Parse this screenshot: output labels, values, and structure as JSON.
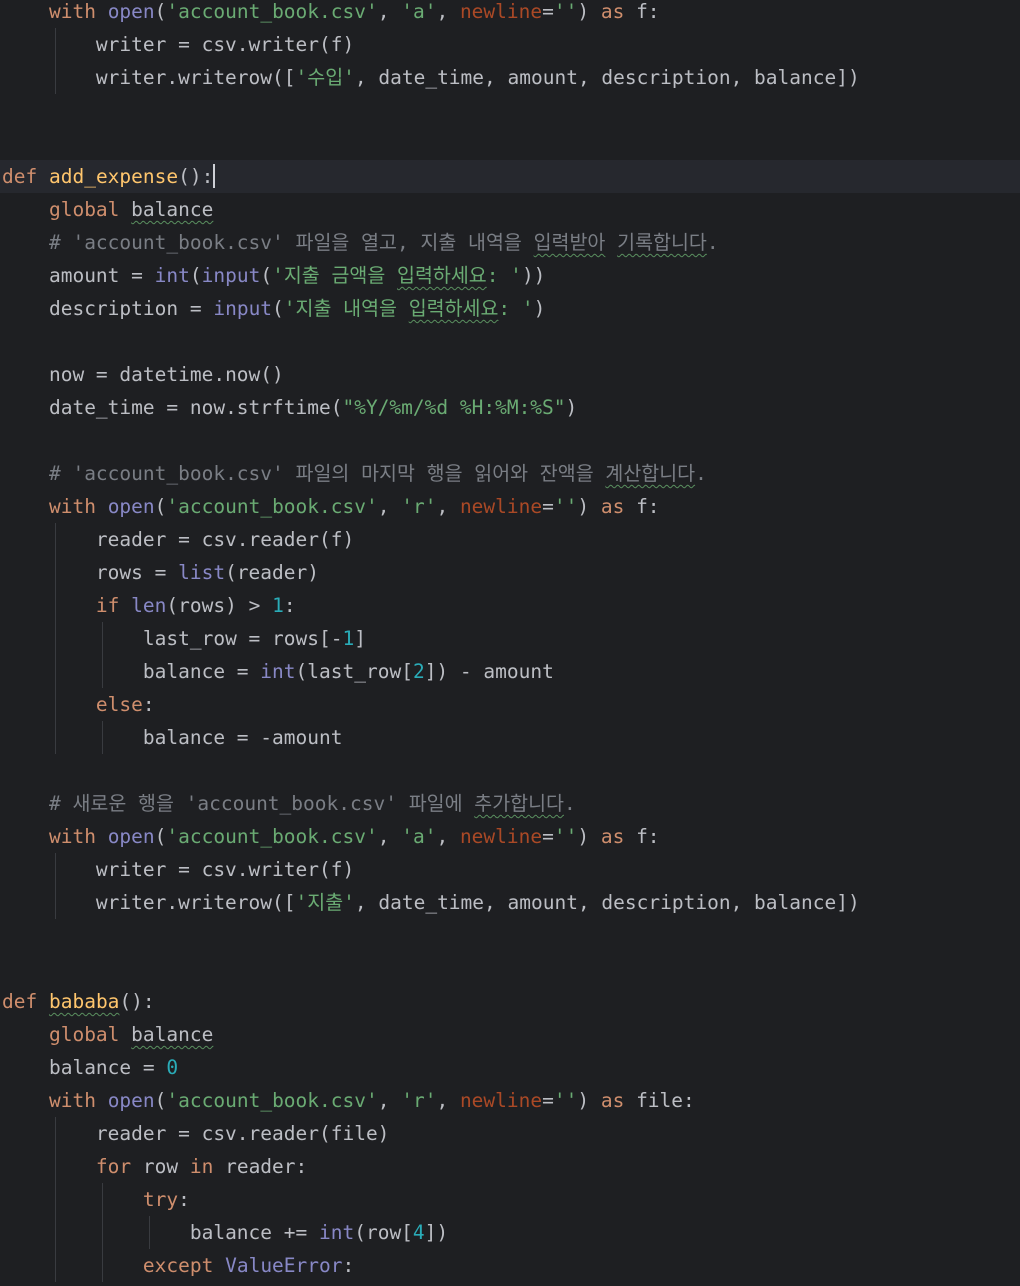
{
  "editor": {
    "language": "python",
    "caret_line": 6,
    "colors": {
      "background": "#1e1f22",
      "current_line": "#26282e",
      "keyword": "#cf8e6d",
      "builtin": "#8888c6",
      "string": "#6aab73",
      "number": "#2aacb8",
      "comment": "#7a7e85",
      "parameter": "#aa4926",
      "function_def": "#ffc66d",
      "plain": "#bcbec4"
    },
    "lines": [
      {
        "indent": 1,
        "tokens": [
          {
            "t": "with",
            "c": "kw"
          },
          {
            "t": " "
          },
          {
            "t": "open",
            "c": "bi"
          },
          {
            "t": "("
          },
          {
            "t": "'account_book.csv'",
            "c": "str"
          },
          {
            "t": ", "
          },
          {
            "t": "'a'",
            "c": "str"
          },
          {
            "t": ", "
          },
          {
            "t": "newline",
            "c": "param"
          },
          {
            "t": "="
          },
          {
            "t": "''",
            "c": "str"
          },
          {
            "t": ") "
          },
          {
            "t": "as",
            "c": "kw"
          },
          {
            "t": " f:"
          }
        ]
      },
      {
        "indent": 2,
        "tokens": [
          {
            "t": "writer = csv.writer(f)"
          }
        ]
      },
      {
        "indent": 2,
        "tokens": [
          {
            "t": "writer.writerow(["
          },
          {
            "t": "'수입'",
            "c": "str"
          },
          {
            "t": ", date_time, amount, description, balance])"
          }
        ]
      },
      {
        "indent": 0,
        "tokens": []
      },
      {
        "indent": 0,
        "tokens": []
      },
      {
        "indent": 0,
        "tokens": [
          {
            "t": "def",
            "c": "kw"
          },
          {
            "t": " "
          },
          {
            "t": "add_expense",
            "c": "def"
          },
          {
            "t": "():"
          }
        ]
      },
      {
        "indent": 1,
        "tokens": [
          {
            "t": "global",
            "c": "kw"
          },
          {
            "t": " "
          },
          {
            "t": "balance",
            "w": true
          }
        ]
      },
      {
        "indent": 1,
        "tokens": [
          {
            "t": "# 'account_book.csv' 파일을 열고, 지출 내역을 ",
            "c": "cm"
          },
          {
            "t": "입력받아",
            "c": "cm",
            "w": true
          },
          {
            "t": " ",
            "c": "cm"
          },
          {
            "t": "기록합니다",
            "c": "cm",
            "w": true
          },
          {
            "t": ".",
            "c": "cm"
          }
        ]
      },
      {
        "indent": 1,
        "tokens": [
          {
            "t": "amount = "
          },
          {
            "t": "int",
            "c": "bi"
          },
          {
            "t": "("
          },
          {
            "t": "input",
            "c": "bi"
          },
          {
            "t": "("
          },
          {
            "t": "'지출 금액을 ",
            "c": "str"
          },
          {
            "t": "입력하세요",
            "c": "str",
            "w": true
          },
          {
            "t": ": '",
            "c": "str"
          },
          {
            "t": "))"
          }
        ]
      },
      {
        "indent": 1,
        "tokens": [
          {
            "t": "description = "
          },
          {
            "t": "input",
            "c": "bi"
          },
          {
            "t": "("
          },
          {
            "t": "'지출 내역을 ",
            "c": "str"
          },
          {
            "t": "입력하세요",
            "c": "str",
            "w": true
          },
          {
            "t": ": '",
            "c": "str"
          },
          {
            "t": ")"
          }
        ]
      },
      {
        "indent": 0,
        "tokens": []
      },
      {
        "indent": 1,
        "tokens": [
          {
            "t": "now = datetime.now()"
          }
        ]
      },
      {
        "indent": 1,
        "tokens": [
          {
            "t": "date_time = now.strftime("
          },
          {
            "t": "\"%Y/%m/%d %H:%M:%S\"",
            "c": "str"
          },
          {
            "t": ")"
          }
        ]
      },
      {
        "indent": 0,
        "tokens": []
      },
      {
        "indent": 1,
        "tokens": [
          {
            "t": "# 'account_book.csv' 파일의 마지막 행을 읽어와 잔액을 ",
            "c": "cm"
          },
          {
            "t": "계산합니다",
            "c": "cm",
            "w": true
          },
          {
            "t": ".",
            "c": "cm"
          }
        ]
      },
      {
        "indent": 1,
        "tokens": [
          {
            "t": "with",
            "c": "kw"
          },
          {
            "t": " "
          },
          {
            "t": "open",
            "c": "bi"
          },
          {
            "t": "("
          },
          {
            "t": "'account_book.csv'",
            "c": "str"
          },
          {
            "t": ", "
          },
          {
            "t": "'r'",
            "c": "str"
          },
          {
            "t": ", "
          },
          {
            "t": "newline",
            "c": "param"
          },
          {
            "t": "="
          },
          {
            "t": "''",
            "c": "str"
          },
          {
            "t": ") "
          },
          {
            "t": "as",
            "c": "kw"
          },
          {
            "t": " f:"
          }
        ]
      },
      {
        "indent": 2,
        "tokens": [
          {
            "t": "reader = csv.reader(f)"
          }
        ]
      },
      {
        "indent": 2,
        "tokens": [
          {
            "t": "rows = "
          },
          {
            "t": "list",
            "c": "bi"
          },
          {
            "t": "(reader)"
          }
        ]
      },
      {
        "indent": 2,
        "tokens": [
          {
            "t": "if",
            "c": "kw"
          },
          {
            "t": " "
          },
          {
            "t": "len",
            "c": "bi"
          },
          {
            "t": "(rows) > "
          },
          {
            "t": "1",
            "c": "num"
          },
          {
            "t": ":"
          }
        ]
      },
      {
        "indent": 3,
        "tokens": [
          {
            "t": "last_row = rows[-"
          },
          {
            "t": "1",
            "c": "num"
          },
          {
            "t": "]"
          }
        ]
      },
      {
        "indent": 3,
        "tokens": [
          {
            "t": "balance = "
          },
          {
            "t": "int",
            "c": "bi"
          },
          {
            "t": "(last_row["
          },
          {
            "t": "2",
            "c": "num"
          },
          {
            "t": "]) - amount"
          }
        ]
      },
      {
        "indent": 2,
        "tokens": [
          {
            "t": "else",
            "c": "kw"
          },
          {
            "t": ":"
          }
        ]
      },
      {
        "indent": 3,
        "tokens": [
          {
            "t": "balance = -amount"
          }
        ]
      },
      {
        "indent": 0,
        "tokens": []
      },
      {
        "indent": 1,
        "tokens": [
          {
            "t": "# 새로운 행을 'account_book.csv' 파일에 ",
            "c": "cm"
          },
          {
            "t": "추가합니다",
            "c": "cm",
            "w": true
          },
          {
            "t": ".",
            "c": "cm"
          }
        ]
      },
      {
        "indent": 1,
        "tokens": [
          {
            "t": "with",
            "c": "kw"
          },
          {
            "t": " "
          },
          {
            "t": "open",
            "c": "bi"
          },
          {
            "t": "("
          },
          {
            "t": "'account_book.csv'",
            "c": "str"
          },
          {
            "t": ", "
          },
          {
            "t": "'a'",
            "c": "str"
          },
          {
            "t": ", "
          },
          {
            "t": "newline",
            "c": "param"
          },
          {
            "t": "="
          },
          {
            "t": "''",
            "c": "str"
          },
          {
            "t": ") "
          },
          {
            "t": "as",
            "c": "kw"
          },
          {
            "t": " f:"
          }
        ]
      },
      {
        "indent": 2,
        "tokens": [
          {
            "t": "writer = csv.writer(f)"
          }
        ]
      },
      {
        "indent": 2,
        "tokens": [
          {
            "t": "writer.writerow(["
          },
          {
            "t": "'지출'",
            "c": "str"
          },
          {
            "t": ", date_time, amount, description, balance])"
          }
        ]
      },
      {
        "indent": 0,
        "tokens": []
      },
      {
        "indent": 0,
        "tokens": []
      },
      {
        "indent": 0,
        "tokens": [
          {
            "t": "def",
            "c": "kw"
          },
          {
            "t": " "
          },
          {
            "t": "bababa",
            "c": "def",
            "w": true
          },
          {
            "t": "():"
          }
        ]
      },
      {
        "indent": 1,
        "tokens": [
          {
            "t": "global",
            "c": "kw"
          },
          {
            "t": " "
          },
          {
            "t": "balance",
            "w": true
          }
        ]
      },
      {
        "indent": 1,
        "tokens": [
          {
            "t": "balance = "
          },
          {
            "t": "0",
            "c": "num"
          }
        ]
      },
      {
        "indent": 1,
        "tokens": [
          {
            "t": "with",
            "c": "kw"
          },
          {
            "t": " "
          },
          {
            "t": "open",
            "c": "bi"
          },
          {
            "t": "("
          },
          {
            "t": "'account_book.csv'",
            "c": "str"
          },
          {
            "t": ", "
          },
          {
            "t": "'r'",
            "c": "str"
          },
          {
            "t": ", "
          },
          {
            "t": "newline",
            "c": "param"
          },
          {
            "t": "="
          },
          {
            "t": "''",
            "c": "str"
          },
          {
            "t": ") "
          },
          {
            "t": "as",
            "c": "kw"
          },
          {
            "t": " file:"
          }
        ]
      },
      {
        "indent": 2,
        "tokens": [
          {
            "t": "reader = csv.reader(file)"
          }
        ]
      },
      {
        "indent": 2,
        "tokens": [
          {
            "t": "for",
            "c": "kw"
          },
          {
            "t": " row "
          },
          {
            "t": "in",
            "c": "kw"
          },
          {
            "t": " reader:"
          }
        ]
      },
      {
        "indent": 3,
        "tokens": [
          {
            "t": "try",
            "c": "kw"
          },
          {
            "t": ":"
          }
        ]
      },
      {
        "indent": 4,
        "tokens": [
          {
            "t": "balance += "
          },
          {
            "t": "int",
            "c": "bi"
          },
          {
            "t": "(row["
          },
          {
            "t": "4",
            "c": "num"
          },
          {
            "t": "])"
          }
        ]
      },
      {
        "indent": 3,
        "tokens": [
          {
            "t": "except",
            "c": "kw"
          },
          {
            "t": " "
          },
          {
            "t": "ValueError",
            "c": "bi"
          },
          {
            "t": ":"
          }
        ]
      }
    ]
  }
}
